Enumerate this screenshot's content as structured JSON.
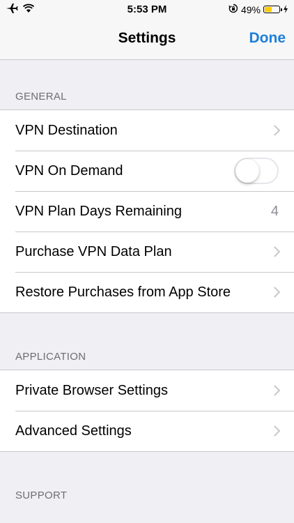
{
  "status_bar": {
    "time": "5:53 PM",
    "battery_percent": "49%",
    "battery_level": 0.49,
    "icons": [
      "airplane-icon",
      "wifi-icon",
      "orientation-lock-icon",
      "battery-icon",
      "charging-bolt-icon"
    ]
  },
  "nav": {
    "title": "Settings",
    "done_label": "Done"
  },
  "colors": {
    "accent": "#1e7fd8",
    "background": "#efeff4",
    "battery": "#ffcc00"
  },
  "sections": {
    "general": {
      "header": "GENERAL",
      "rows": [
        {
          "label": "VPN Destination",
          "accessory": "chevron"
        },
        {
          "label": "VPN On Demand",
          "accessory": "toggle",
          "toggle_on": false
        },
        {
          "label": "VPN Plan Days Remaining",
          "accessory": "value",
          "value": "4"
        },
        {
          "label": "Purchase VPN Data Plan",
          "accessory": "chevron"
        },
        {
          "label": "Restore Purchases from App Store",
          "accessory": "chevron"
        }
      ]
    },
    "application": {
      "header": "APPLICATION",
      "rows": [
        {
          "label": "Private Browser Settings",
          "accessory": "chevron"
        },
        {
          "label": "Advanced Settings",
          "accessory": "chevron"
        }
      ]
    },
    "support": {
      "header": "SUPPORT"
    }
  }
}
